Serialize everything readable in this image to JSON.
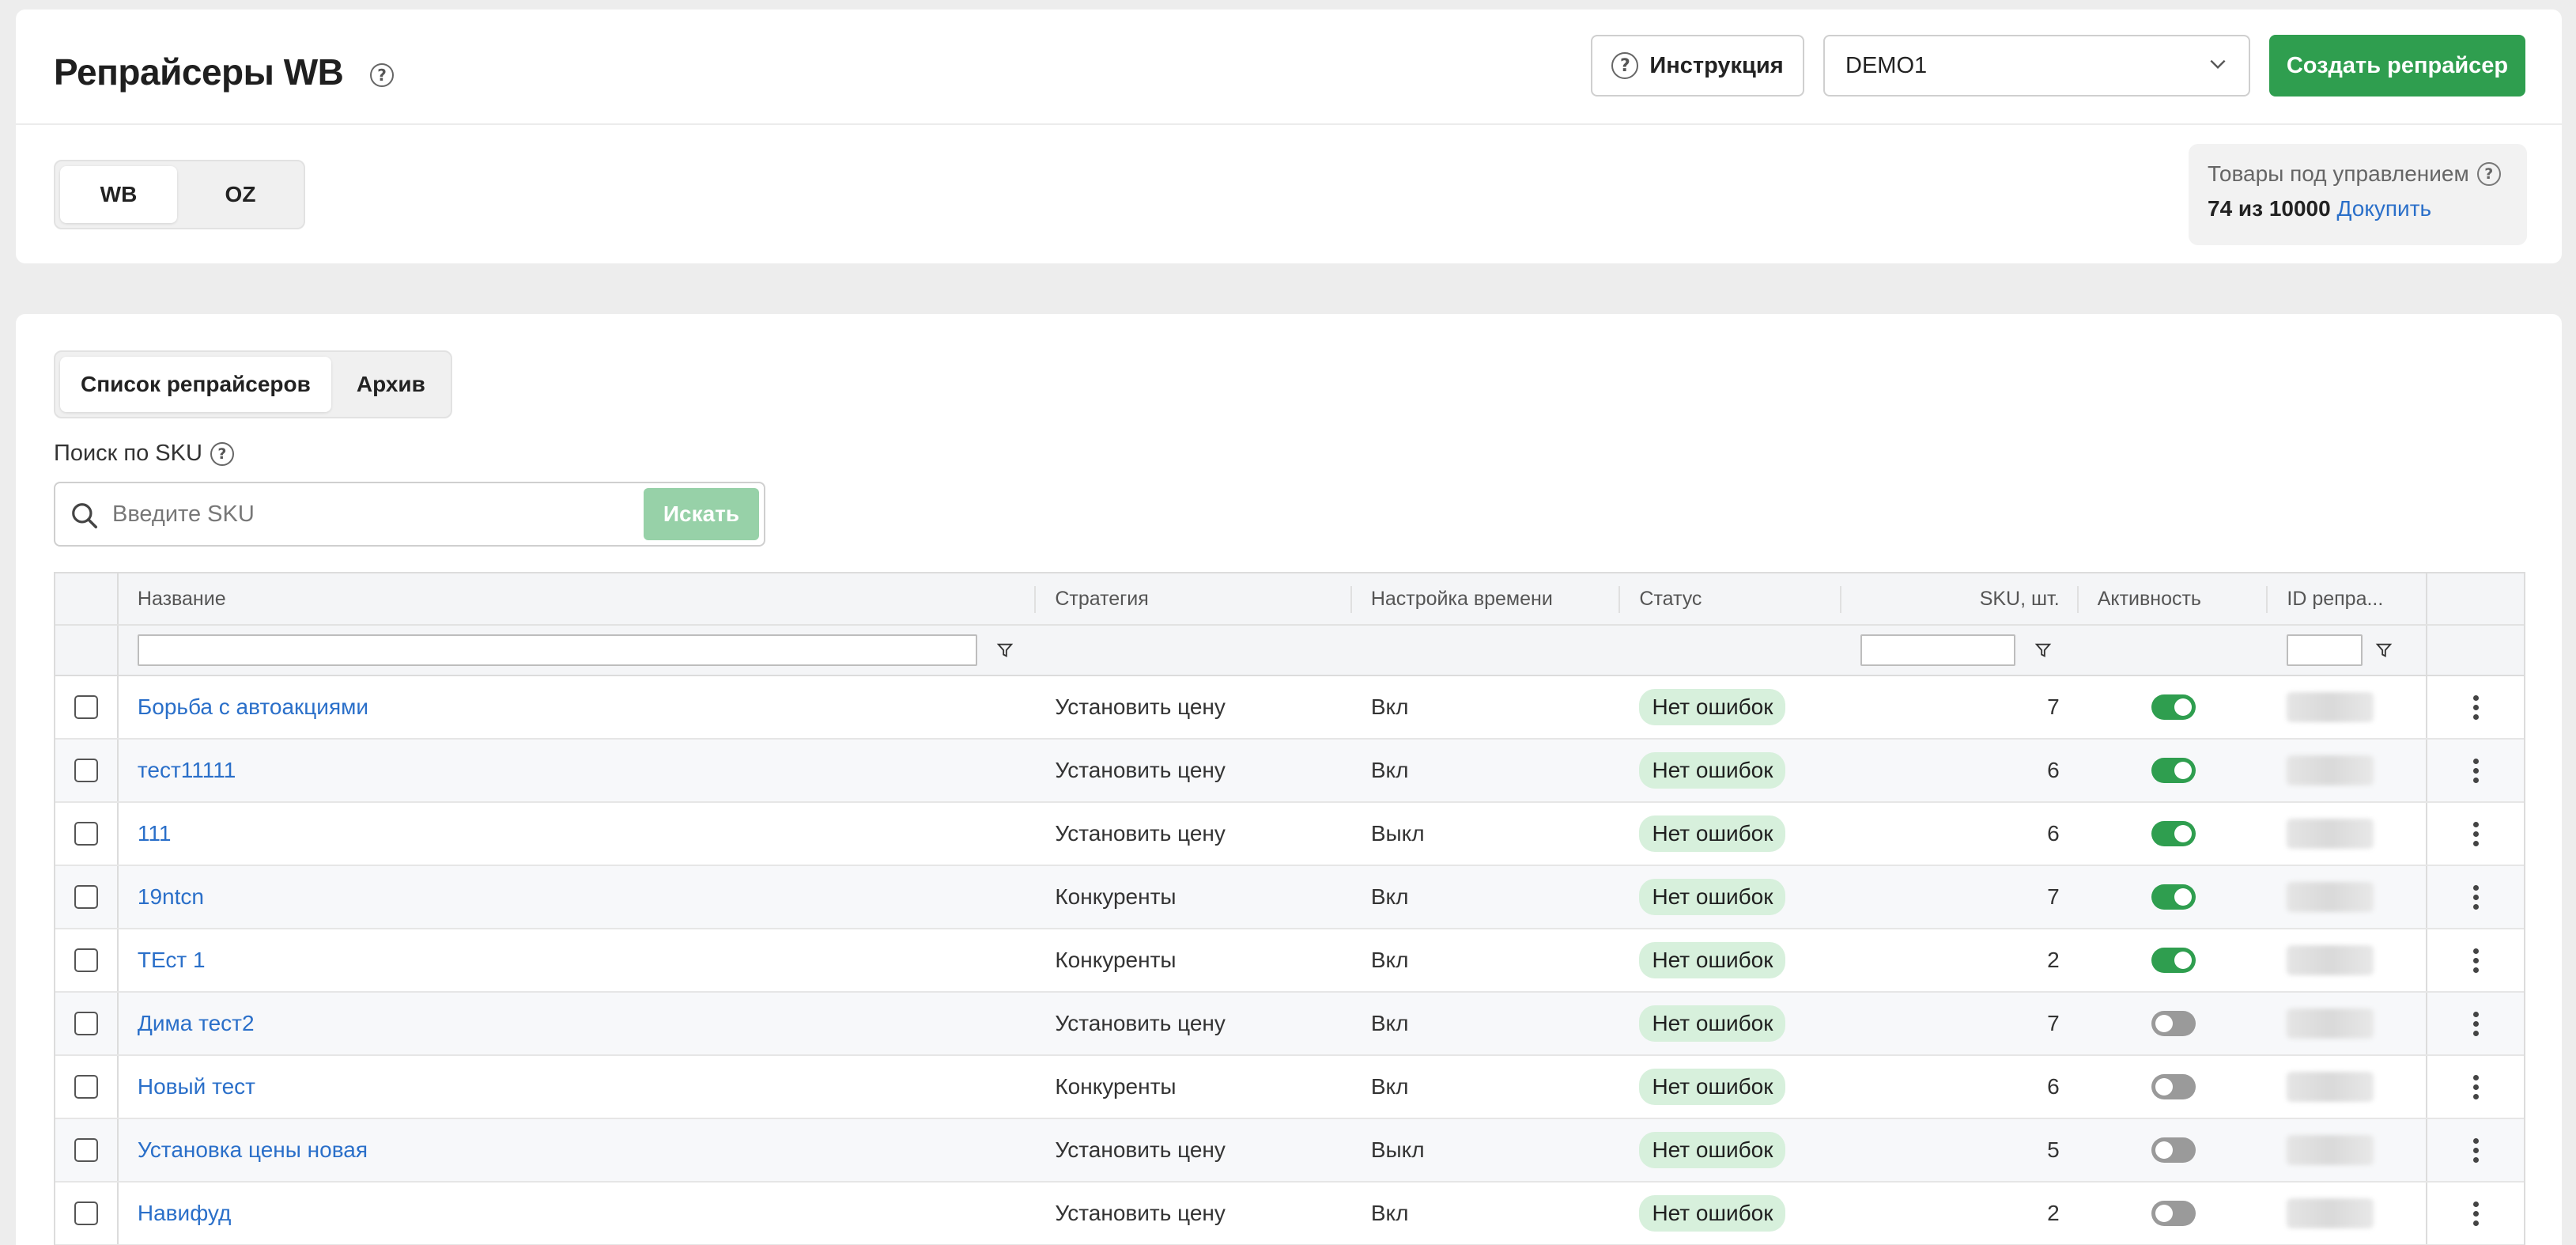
{
  "header": {
    "title": "Репрайсеры WB",
    "instruction_label": "Инструкция",
    "account_selected": "DEMO1",
    "create_label": "Создать репрайсер"
  },
  "marketplace_tabs": [
    {
      "label": "WB",
      "active": true
    },
    {
      "label": "OZ",
      "active": false
    }
  ],
  "quota": {
    "label": "Товары под управлением",
    "value": "74 из 10000",
    "link": "Докупить"
  },
  "list_tabs": [
    {
      "label": "Список репрайсеров",
      "active": true
    },
    {
      "label": "Архив",
      "active": false
    }
  ],
  "search": {
    "label": "Поиск по SKU",
    "placeholder": "Введите SKU",
    "button_label": "Искать"
  },
  "table": {
    "columns": {
      "name": "Название",
      "strategy": "Стратегия",
      "time": "Настройка времени",
      "status": "Статус",
      "sku": "SKU, шт.",
      "activity": "Активность",
      "id": "ID репра..."
    },
    "rows": [
      {
        "name": "Борьба с автоакциями",
        "strategy": "Установить цену",
        "time": "Вкл",
        "status": "Нет ошибок",
        "sku": "7",
        "active": true
      },
      {
        "name": "тест11111",
        "strategy": "Установить цену",
        "time": "Вкл",
        "status": "Нет ошибок",
        "sku": "6",
        "active": true
      },
      {
        "name": "111",
        "strategy": "Установить цену",
        "time": "Выкл",
        "status": "Нет ошибок",
        "sku": "6",
        "active": true
      },
      {
        "name": "19ntcn",
        "strategy": "Конкуренты",
        "time": "Вкл",
        "status": "Нет ошибок",
        "sku": "7",
        "active": true
      },
      {
        "name": "ТЕст 1",
        "strategy": "Конкуренты",
        "time": "Вкл",
        "status": "Нет ошибок",
        "sku": "2",
        "active": true
      },
      {
        "name": "Дима тест2",
        "strategy": "Установить цену",
        "time": "Вкл",
        "status": "Нет ошибок",
        "sku": "7",
        "active": false
      },
      {
        "name": "Новый тест",
        "strategy": "Конкуренты",
        "time": "Вкл",
        "status": "Нет ошибок",
        "sku": "6",
        "active": false
      },
      {
        "name": "Установка цены новая",
        "strategy": "Установить цену",
        "time": "Выкл",
        "status": "Нет ошибок",
        "sku": "5",
        "active": false
      },
      {
        "name": "Навифуд",
        "strategy": "Установить цену",
        "time": "Вкл",
        "status": "Нет ошибок",
        "sku": "2",
        "active": false
      }
    ]
  },
  "colors": {
    "primary": "#2f9e4f",
    "primary_disabled": "#97d1a8",
    "link": "#2a6fc9",
    "badge_bg": "#d7f0dc"
  },
  "icons": {
    "help": "question-circle-icon",
    "chevron": "chevron-down-icon",
    "search": "search-icon",
    "filter": "filter-icon",
    "menu": "more-vertical-icon"
  }
}
